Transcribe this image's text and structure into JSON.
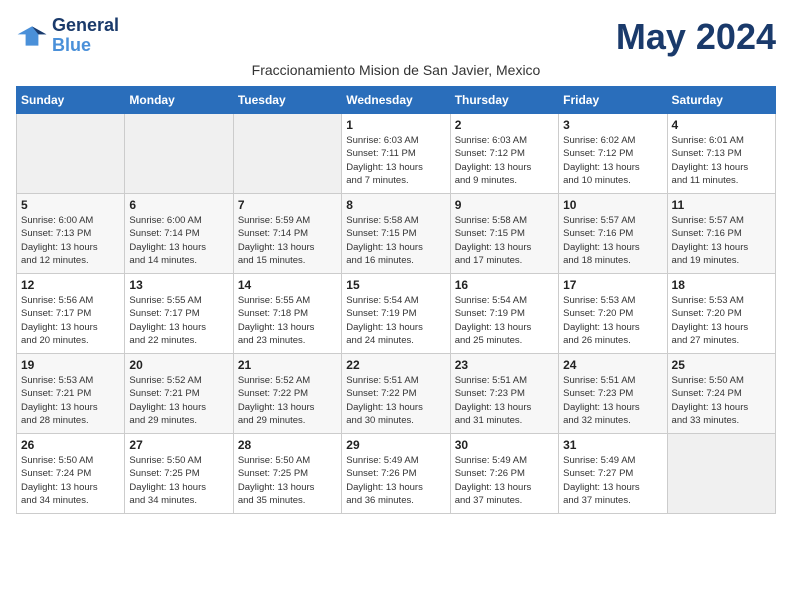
{
  "logo": {
    "line1": "General",
    "line2": "Blue"
  },
  "title": "May 2024",
  "subtitle": "Fraccionamiento Mision de San Javier, Mexico",
  "days_of_week": [
    "Sunday",
    "Monday",
    "Tuesday",
    "Wednesday",
    "Thursday",
    "Friday",
    "Saturday"
  ],
  "weeks": [
    [
      {
        "day": "",
        "info": ""
      },
      {
        "day": "",
        "info": ""
      },
      {
        "day": "",
        "info": ""
      },
      {
        "day": "1",
        "info": "Sunrise: 6:03 AM\nSunset: 7:11 PM\nDaylight: 13 hours\nand 7 minutes."
      },
      {
        "day": "2",
        "info": "Sunrise: 6:03 AM\nSunset: 7:12 PM\nDaylight: 13 hours\nand 9 minutes."
      },
      {
        "day": "3",
        "info": "Sunrise: 6:02 AM\nSunset: 7:12 PM\nDaylight: 13 hours\nand 10 minutes."
      },
      {
        "day": "4",
        "info": "Sunrise: 6:01 AM\nSunset: 7:13 PM\nDaylight: 13 hours\nand 11 minutes."
      }
    ],
    [
      {
        "day": "5",
        "info": "Sunrise: 6:00 AM\nSunset: 7:13 PM\nDaylight: 13 hours\nand 12 minutes."
      },
      {
        "day": "6",
        "info": "Sunrise: 6:00 AM\nSunset: 7:14 PM\nDaylight: 13 hours\nand 14 minutes."
      },
      {
        "day": "7",
        "info": "Sunrise: 5:59 AM\nSunset: 7:14 PM\nDaylight: 13 hours\nand 15 minutes."
      },
      {
        "day": "8",
        "info": "Sunrise: 5:58 AM\nSunset: 7:15 PM\nDaylight: 13 hours\nand 16 minutes."
      },
      {
        "day": "9",
        "info": "Sunrise: 5:58 AM\nSunset: 7:15 PM\nDaylight: 13 hours\nand 17 minutes."
      },
      {
        "day": "10",
        "info": "Sunrise: 5:57 AM\nSunset: 7:16 PM\nDaylight: 13 hours\nand 18 minutes."
      },
      {
        "day": "11",
        "info": "Sunrise: 5:57 AM\nSunset: 7:16 PM\nDaylight: 13 hours\nand 19 minutes."
      }
    ],
    [
      {
        "day": "12",
        "info": "Sunrise: 5:56 AM\nSunset: 7:17 PM\nDaylight: 13 hours\nand 20 minutes."
      },
      {
        "day": "13",
        "info": "Sunrise: 5:55 AM\nSunset: 7:17 PM\nDaylight: 13 hours\nand 22 minutes."
      },
      {
        "day": "14",
        "info": "Sunrise: 5:55 AM\nSunset: 7:18 PM\nDaylight: 13 hours\nand 23 minutes."
      },
      {
        "day": "15",
        "info": "Sunrise: 5:54 AM\nSunset: 7:19 PM\nDaylight: 13 hours\nand 24 minutes."
      },
      {
        "day": "16",
        "info": "Sunrise: 5:54 AM\nSunset: 7:19 PM\nDaylight: 13 hours\nand 25 minutes."
      },
      {
        "day": "17",
        "info": "Sunrise: 5:53 AM\nSunset: 7:20 PM\nDaylight: 13 hours\nand 26 minutes."
      },
      {
        "day": "18",
        "info": "Sunrise: 5:53 AM\nSunset: 7:20 PM\nDaylight: 13 hours\nand 27 minutes."
      }
    ],
    [
      {
        "day": "19",
        "info": "Sunrise: 5:53 AM\nSunset: 7:21 PM\nDaylight: 13 hours\nand 28 minutes."
      },
      {
        "day": "20",
        "info": "Sunrise: 5:52 AM\nSunset: 7:21 PM\nDaylight: 13 hours\nand 29 minutes."
      },
      {
        "day": "21",
        "info": "Sunrise: 5:52 AM\nSunset: 7:22 PM\nDaylight: 13 hours\nand 29 minutes."
      },
      {
        "day": "22",
        "info": "Sunrise: 5:51 AM\nSunset: 7:22 PM\nDaylight: 13 hours\nand 30 minutes."
      },
      {
        "day": "23",
        "info": "Sunrise: 5:51 AM\nSunset: 7:23 PM\nDaylight: 13 hours\nand 31 minutes."
      },
      {
        "day": "24",
        "info": "Sunrise: 5:51 AM\nSunset: 7:23 PM\nDaylight: 13 hours\nand 32 minutes."
      },
      {
        "day": "25",
        "info": "Sunrise: 5:50 AM\nSunset: 7:24 PM\nDaylight: 13 hours\nand 33 minutes."
      }
    ],
    [
      {
        "day": "26",
        "info": "Sunrise: 5:50 AM\nSunset: 7:24 PM\nDaylight: 13 hours\nand 34 minutes."
      },
      {
        "day": "27",
        "info": "Sunrise: 5:50 AM\nSunset: 7:25 PM\nDaylight: 13 hours\nand 34 minutes."
      },
      {
        "day": "28",
        "info": "Sunrise: 5:50 AM\nSunset: 7:25 PM\nDaylight: 13 hours\nand 35 minutes."
      },
      {
        "day": "29",
        "info": "Sunrise: 5:49 AM\nSunset: 7:26 PM\nDaylight: 13 hours\nand 36 minutes."
      },
      {
        "day": "30",
        "info": "Sunrise: 5:49 AM\nSunset: 7:26 PM\nDaylight: 13 hours\nand 37 minutes."
      },
      {
        "day": "31",
        "info": "Sunrise: 5:49 AM\nSunset: 7:27 PM\nDaylight: 13 hours\nand 37 minutes."
      },
      {
        "day": "",
        "info": ""
      }
    ]
  ]
}
